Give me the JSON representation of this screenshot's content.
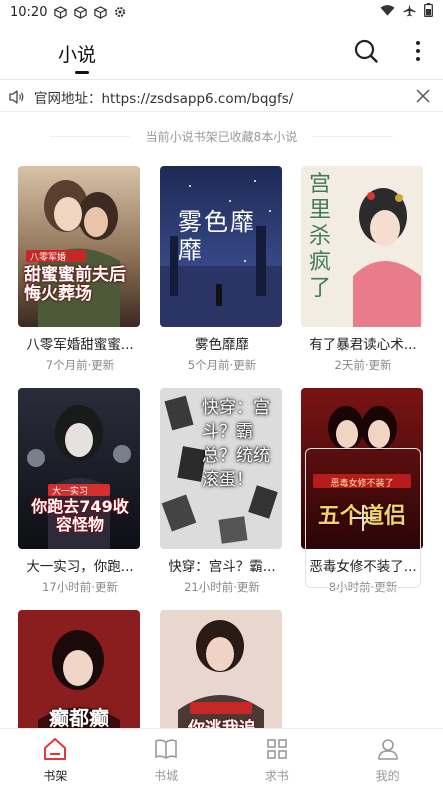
{
  "status_bar": {
    "time": "10:20"
  },
  "header": {
    "title": "小说"
  },
  "notice": {
    "text": "官网地址：https://zsdsapp6.com/bqgfs/"
  },
  "shelf_info": "当前小说书架已收藏8本小说",
  "books": [
    {
      "title": "八零军婚甜蜜蜜...",
      "updated": "7个月前·更新",
      "cover_text": "甜蜜蜜前夫后悔火葬场",
      "cover_badge": "八零军婚"
    },
    {
      "title": "雾色靡靡",
      "updated": "5个月前·更新",
      "cover_text": "雾色靡靡"
    },
    {
      "title": "有了暴君读心术...",
      "updated": "2天前·更新",
      "cover_text": "宫里杀疯了"
    },
    {
      "title": "大一实习，你跑...",
      "updated": "17小时前·更新",
      "cover_text": "你跑去749收容怪物",
      "cover_badge": "大一实习"
    },
    {
      "title": "快穿：宫斗？霸...",
      "updated": "21小时前·更新",
      "cover_text": "快穿：宫斗？霸总？统统滚蛋！"
    },
    {
      "title": "恶毒女修不装了...",
      "updated": "8小时前·更新",
      "cover_text": "五个道侣",
      "cover_badge": "恶毒女修不装了"
    },
    {
      "cover_text": "癫都癫"
    },
    {
      "cover_text": "你逃我追"
    }
  ],
  "nav": [
    {
      "label": "书架",
      "icon": "home-icon",
      "active": true
    },
    {
      "label": "书城",
      "icon": "book-icon",
      "active": false
    },
    {
      "label": "求书",
      "icon": "grid-icon",
      "active": false
    },
    {
      "label": "我的",
      "icon": "person-icon",
      "active": false
    }
  ],
  "colors": {
    "accent": "#e53935",
    "muted": "#999999"
  }
}
